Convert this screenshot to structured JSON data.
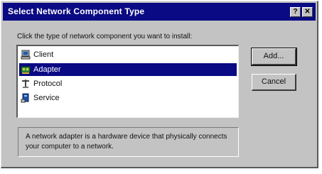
{
  "window": {
    "title": "Select Network Component Type",
    "help_button": "?",
    "close_button": "✕"
  },
  "instruction": "Click the type of network component you want to install:",
  "components": [
    {
      "label": "Client",
      "icon": "client-computer-icon",
      "selected": false
    },
    {
      "label": "Adapter",
      "icon": "network-adapter-icon",
      "selected": true
    },
    {
      "label": "Protocol",
      "icon": "protocol-icon",
      "selected": false
    },
    {
      "label": "Service",
      "icon": "service-icon",
      "selected": false
    }
  ],
  "buttons": {
    "add": "Add...",
    "cancel": "Cancel"
  },
  "description": "A network adapter is a hardware device that physically connects your computer to a network.",
  "colors": {
    "titlebar": "#0a0a84",
    "dialog_face": "#c3c3c3",
    "selection": "#0a0a84"
  }
}
